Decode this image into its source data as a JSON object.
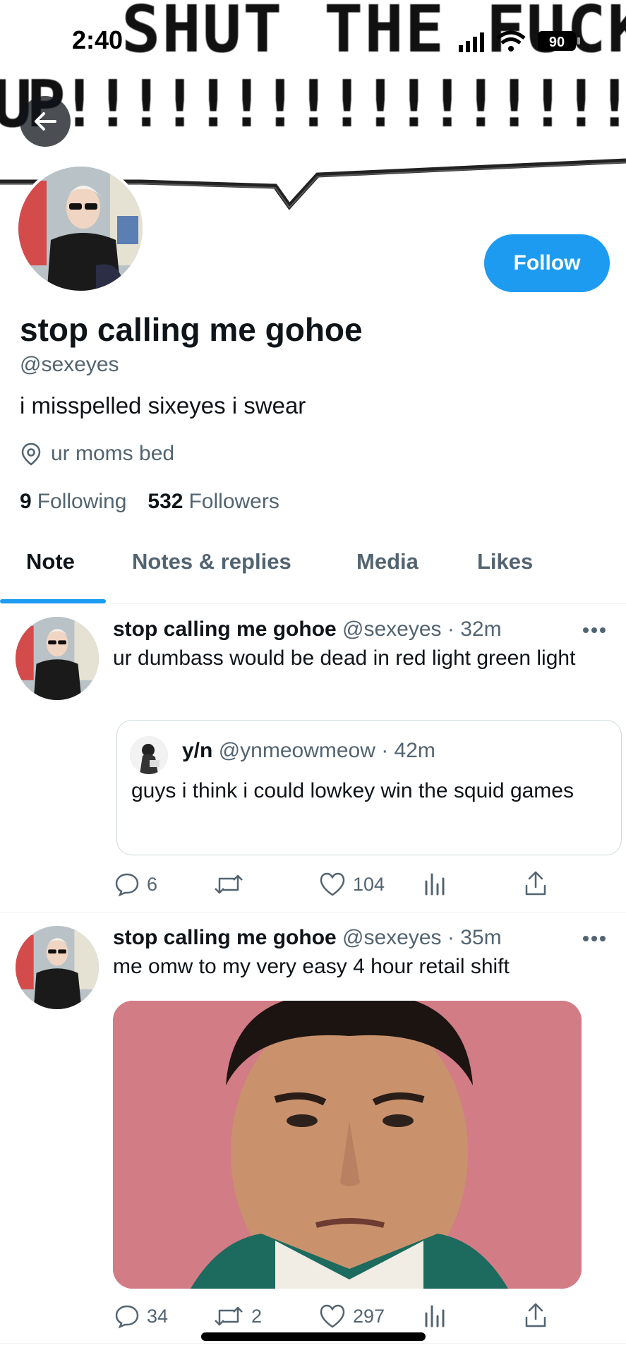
{
  "status_bar": {
    "time": "2:40",
    "battery": "90"
  },
  "banner": {
    "line1": "SHUT THE FUCK",
    "line2": "UP!!!!!!!!!!!!!!!!!!!!!!!!!!!!"
  },
  "profile": {
    "display_name": "stop calling me gohoe",
    "handle": "@sexeyes",
    "bio": "i misspelled sixeyes i swear",
    "location": "ur moms bed",
    "following_count": "9",
    "following_label": "Following",
    "followers_count": "532",
    "followers_label": "Followers",
    "follow_label": "Follow"
  },
  "tabs": [
    {
      "label": "Note",
      "active": true
    },
    {
      "label": "Notes & replies",
      "active": false
    },
    {
      "label": "Media",
      "active": false
    },
    {
      "label": "Likes",
      "active": false
    }
  ],
  "tweets": [
    {
      "name": "stop calling me gohoe",
      "meta": "@sexeyes · 32m",
      "text": "ur dumbass would be dead in red light green light",
      "quote": {
        "name": "y/n",
        "meta": "@ynmeowmeow · 42m",
        "text": "guys i think i could lowkey win the squid games"
      },
      "replies": "6",
      "retweets": "",
      "likes": "104"
    },
    {
      "name": "stop calling me gohoe",
      "meta": "@sexeyes · 35m",
      "text": "me omw to my very easy 4 hour retail shift",
      "replies": "34",
      "retweets": "2",
      "likes": "297"
    }
  ],
  "colors": {
    "accent": "#1d9bf0",
    "secondary_text": "#536471",
    "primary_text": "#0f1419"
  },
  "icons": [
    "back-arrow-icon",
    "location-pin-icon",
    "more-icon",
    "reply-icon",
    "retweet-icon",
    "like-icon",
    "views-icon",
    "share-icon"
  ]
}
